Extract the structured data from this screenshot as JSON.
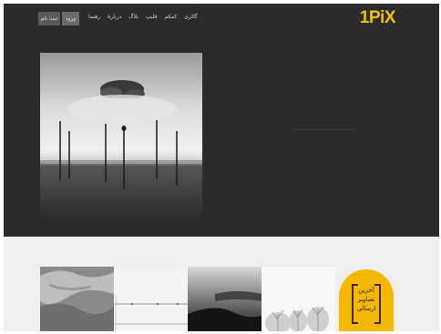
{
  "header": {
    "logo": "1PiX",
    "buttons": {
      "register": "ثبت نام",
      "login": "ورود"
    },
    "nav": [
      "گالری",
      "کمکم",
      "فلیپ",
      "بلاگ",
      "دربارهٔ",
      "رهنما"
    ]
  },
  "hero": {
    "image_icon": "foggy-landscape-photo"
  },
  "gallery": {
    "thumbs": [
      {
        "icon": "bedsheet-photo"
      },
      {
        "icon": "minimal-line-photo"
      },
      {
        "icon": "dark-coast-photo"
      },
      {
        "icon": "winter-trees-photo"
      }
    ]
  },
  "badge": {
    "lines": [
      "آخرین",
      "تصاویر",
      "ارسالی"
    ],
    "color": "#f5b800"
  },
  "colors": {
    "header_bg": "#2b2b2b",
    "accent": "#f2c100",
    "page_bg": "#efefef"
  }
}
